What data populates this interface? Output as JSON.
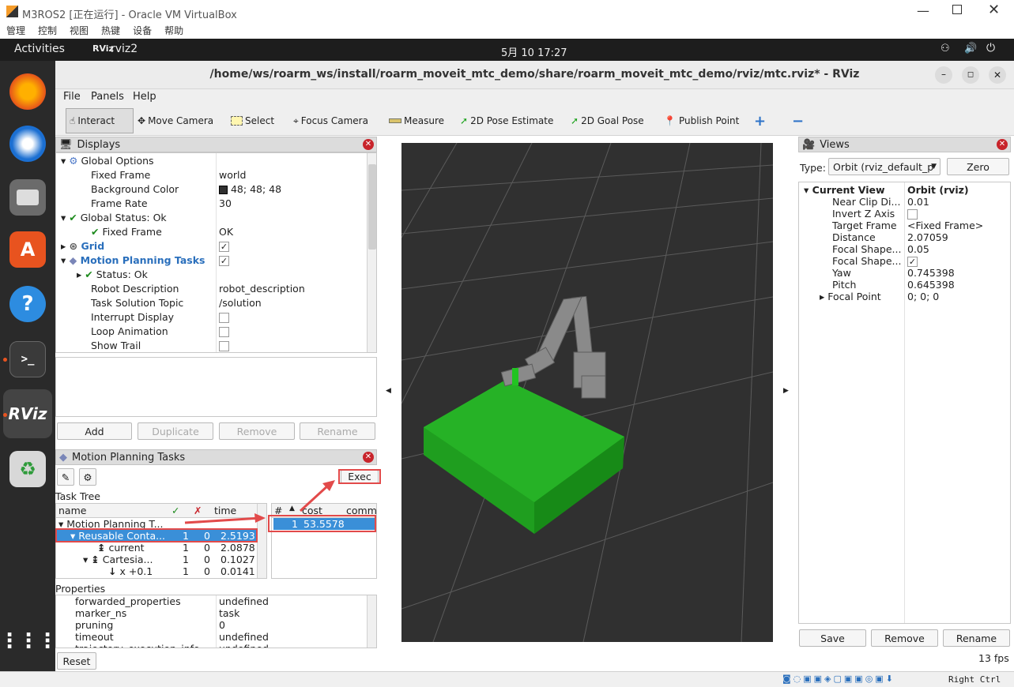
{
  "vbox": {
    "title": "M3ROS2 [正在运行] - Oracle VM VirtualBox",
    "menu": [
      "管理",
      "控制",
      "视图",
      "热键",
      "设备",
      "帮助"
    ],
    "status_right": "Right Ctrl"
  },
  "topbar": {
    "activities": "Activities",
    "app": "rviz2",
    "clock": "5月 10  17:27"
  },
  "dock": {
    "items": [
      "firefox-icon",
      "thunderbird-icon",
      "files-icon",
      "software-icon",
      "help-icon",
      "terminal-icon",
      "rviz-icon",
      "trash-icon",
      "apps-grid-icon"
    ]
  },
  "rviz": {
    "title": "/home/ws/roarm_ws/install/roarm_moveit_mtc_demo/share/roarm_moveit_mtc_demo/rviz/mtc.rviz* - RViz",
    "menu": [
      "File",
      "Panels",
      "Help"
    ],
    "toolbar": {
      "interact": "Interact",
      "move_camera": "Move Camera",
      "select": "Select",
      "focus_camera": "Focus Camera",
      "measure": "Measure",
      "pose_estimate": "2D Pose Estimate",
      "goal_pose": "2D Goal Pose",
      "publish_point": "Publish Point"
    },
    "displays": {
      "title": "Displays",
      "rows": [
        {
          "label": "Global Options",
          "value": ""
        },
        {
          "label": "Fixed Frame",
          "value": "world"
        },
        {
          "label": "Background Color",
          "value": "48; 48; 48"
        },
        {
          "label": "Frame Rate",
          "value": "30"
        },
        {
          "label": "Global Status: Ok",
          "value": ""
        },
        {
          "label": "Fixed Frame",
          "value": "OK"
        },
        {
          "label": "Grid",
          "value": ""
        },
        {
          "label": "Motion Planning Tasks",
          "value": ""
        },
        {
          "label": "Status: Ok",
          "value": ""
        },
        {
          "label": "Robot Description",
          "value": "robot_description"
        },
        {
          "label": "Task Solution Topic",
          "value": "/solution"
        },
        {
          "label": "Interrupt Display",
          "value": ""
        },
        {
          "label": "Loop Animation",
          "value": ""
        },
        {
          "label": "Show Trail",
          "value": ""
        }
      ],
      "buttons": {
        "add": "Add",
        "duplicate": "Duplicate",
        "remove": "Remove",
        "rename": "Rename"
      }
    },
    "mpt": {
      "title": "Motion Planning Tasks",
      "exec": "Exec",
      "task_tree_label": "Task Tree",
      "cols": {
        "name": "name",
        "ok": "✓",
        "fail": "✗",
        "time": "time"
      },
      "rows": [
        {
          "name": "Motion Planning T...",
          "ok": "",
          "fail": "",
          "time": ""
        },
        {
          "name": "Reusable Conta...",
          "ok": "1",
          "fail": "0",
          "time": "2.5193"
        },
        {
          "name": "current",
          "ok": "1",
          "fail": "0",
          "time": "2.0878"
        },
        {
          "name": "Cartesia...",
          "ok": "1",
          "fail": "0",
          "time": "0.1027"
        },
        {
          "name": "x +0.1",
          "ok": "1",
          "fail": "0",
          "time": "0.0141"
        }
      ],
      "sol_cols": {
        "num": "#",
        "cost": "cost",
        "comment": "comm"
      },
      "solutions": [
        {
          "num": "1",
          "cost": "53.5578"
        }
      ],
      "properties_label": "Properties",
      "properties": [
        {
          "label": "forwarded_properties",
          "value": "undefined"
        },
        {
          "label": "marker_ns",
          "value": "task"
        },
        {
          "label": "pruning",
          "value": "0"
        },
        {
          "label": "timeout",
          "value": "undefined"
        },
        {
          "label": "trajectory_execution_info",
          "value": "undefined"
        }
      ],
      "reset": "Reset"
    },
    "views": {
      "title": "Views",
      "type_label": "Type:",
      "type_value": "Orbit (rviz_default_p",
      "zero": "Zero",
      "current_view": "Current View",
      "current_type": "Orbit (rviz)",
      "rows": [
        {
          "label": "Near Clip Di...",
          "value": "0.01"
        },
        {
          "label": "Invert Z Axis",
          "value": ""
        },
        {
          "label": "Target Frame",
          "value": "<Fixed Frame>"
        },
        {
          "label": "Distance",
          "value": "2.07059"
        },
        {
          "label": "Focal Shape...",
          "value": "0.05"
        },
        {
          "label": "Focal Shape...",
          "value": ""
        },
        {
          "label": "Yaw",
          "value": "0.745398"
        },
        {
          "label": "Pitch",
          "value": "0.645398"
        },
        {
          "label": "Focal Point",
          "value": "0; 0; 0"
        }
      ],
      "buttons": {
        "save": "Save",
        "remove": "Remove",
        "rename": "Rename"
      }
    },
    "fps": "13 fps"
  },
  "colors": {
    "bg": "#303030",
    "green": "#1fa81f",
    "accent": "#3a8fd8",
    "red_annot": "#e24a4a"
  }
}
